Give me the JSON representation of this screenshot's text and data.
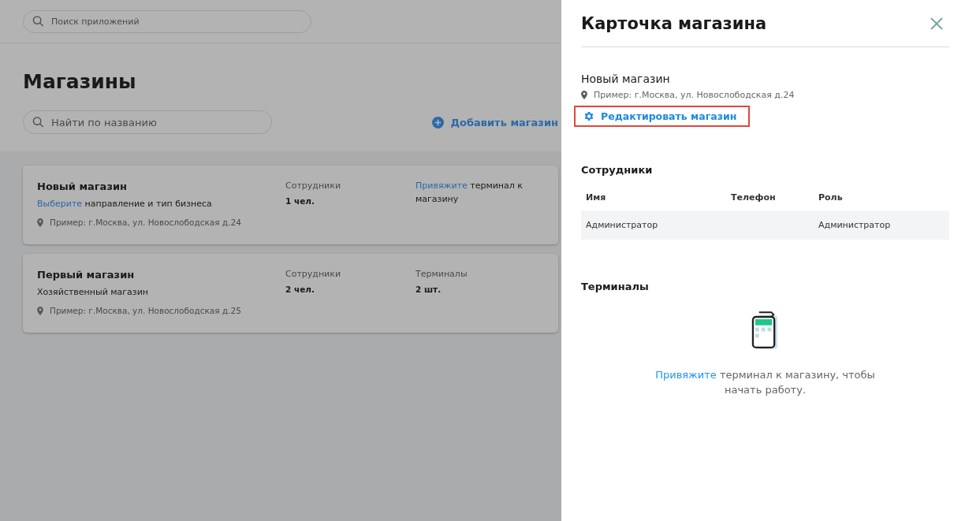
{
  "app_search": {
    "placeholder": "Поиск приложений"
  },
  "page": {
    "title": "Магазины",
    "search": {
      "placeholder": "Найти по названию"
    },
    "add_button": "Добавить магазин"
  },
  "stores": [
    {
      "name": "Новый магазин",
      "subtitle": {
        "link": "Выберите",
        "text": " направление и тип бизнеса"
      },
      "address": "Пример: г.Москва, ул. Новослободская д.24",
      "employees": {
        "label": "Сотрудники",
        "value": "1 чел."
      },
      "terminals": {
        "kind": "prompt",
        "link": "Привяжите",
        "text": " терминал к магазину"
      }
    },
    {
      "name": "Первый магазин",
      "subtitle": {
        "text": "Хозяйственный магазин"
      },
      "address": "Пример: г.Москва, ул. Новослободская д.25",
      "employees": {
        "label": "Сотрудники",
        "value": "2 чел."
      },
      "terminals": {
        "kind": "count",
        "label": "Терминалы",
        "value": "2 шт."
      }
    }
  ],
  "drawer": {
    "title": "Карточка магазина",
    "store_name": "Новый магазин",
    "address": "Пример: г.Москва, ул. Новослободская д.24",
    "edit_button": "Редактировать магазин",
    "employees": {
      "title": "Сотрудники",
      "columns": [
        "Имя",
        "Телефон",
        "Роль"
      ],
      "rows": [
        {
          "name": "Администратор",
          "role": "Администратор"
        }
      ]
    },
    "terminals": {
      "title": "Терминалы",
      "empty": {
        "link": "Привяжите",
        "text": " терминал к магазину, чтобы начать работу."
      }
    }
  }
}
